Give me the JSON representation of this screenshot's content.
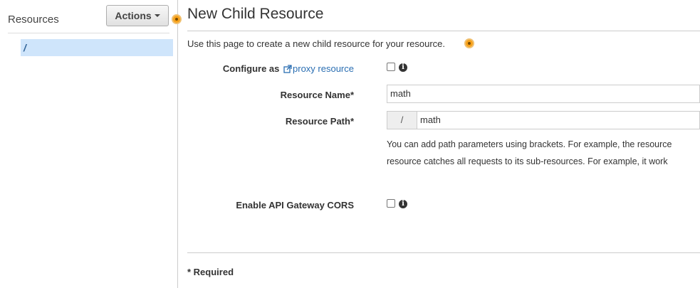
{
  "sidebar": {
    "title": "Resources",
    "actions_label": "Actions",
    "tree": [
      {
        "label": "/"
      }
    ]
  },
  "main": {
    "title": "New Child Resource",
    "intro": "Use this page to create a new child resource for your resource.",
    "configure_as_label": "Configure as",
    "proxy_link": "proxy resource",
    "resource_name_label": "Resource Name*",
    "resource_name_value": "math",
    "resource_path_label": "Resource Path*",
    "resource_path_prefix": "/",
    "resource_path_value": "math",
    "help_line1": "You can add path parameters using brackets. For example, the resource",
    "help_line2": "resource catches all requests to its sub-resources. For example, it work",
    "cors_label": "Enable API Gateway CORS",
    "required_note": "* Required"
  }
}
